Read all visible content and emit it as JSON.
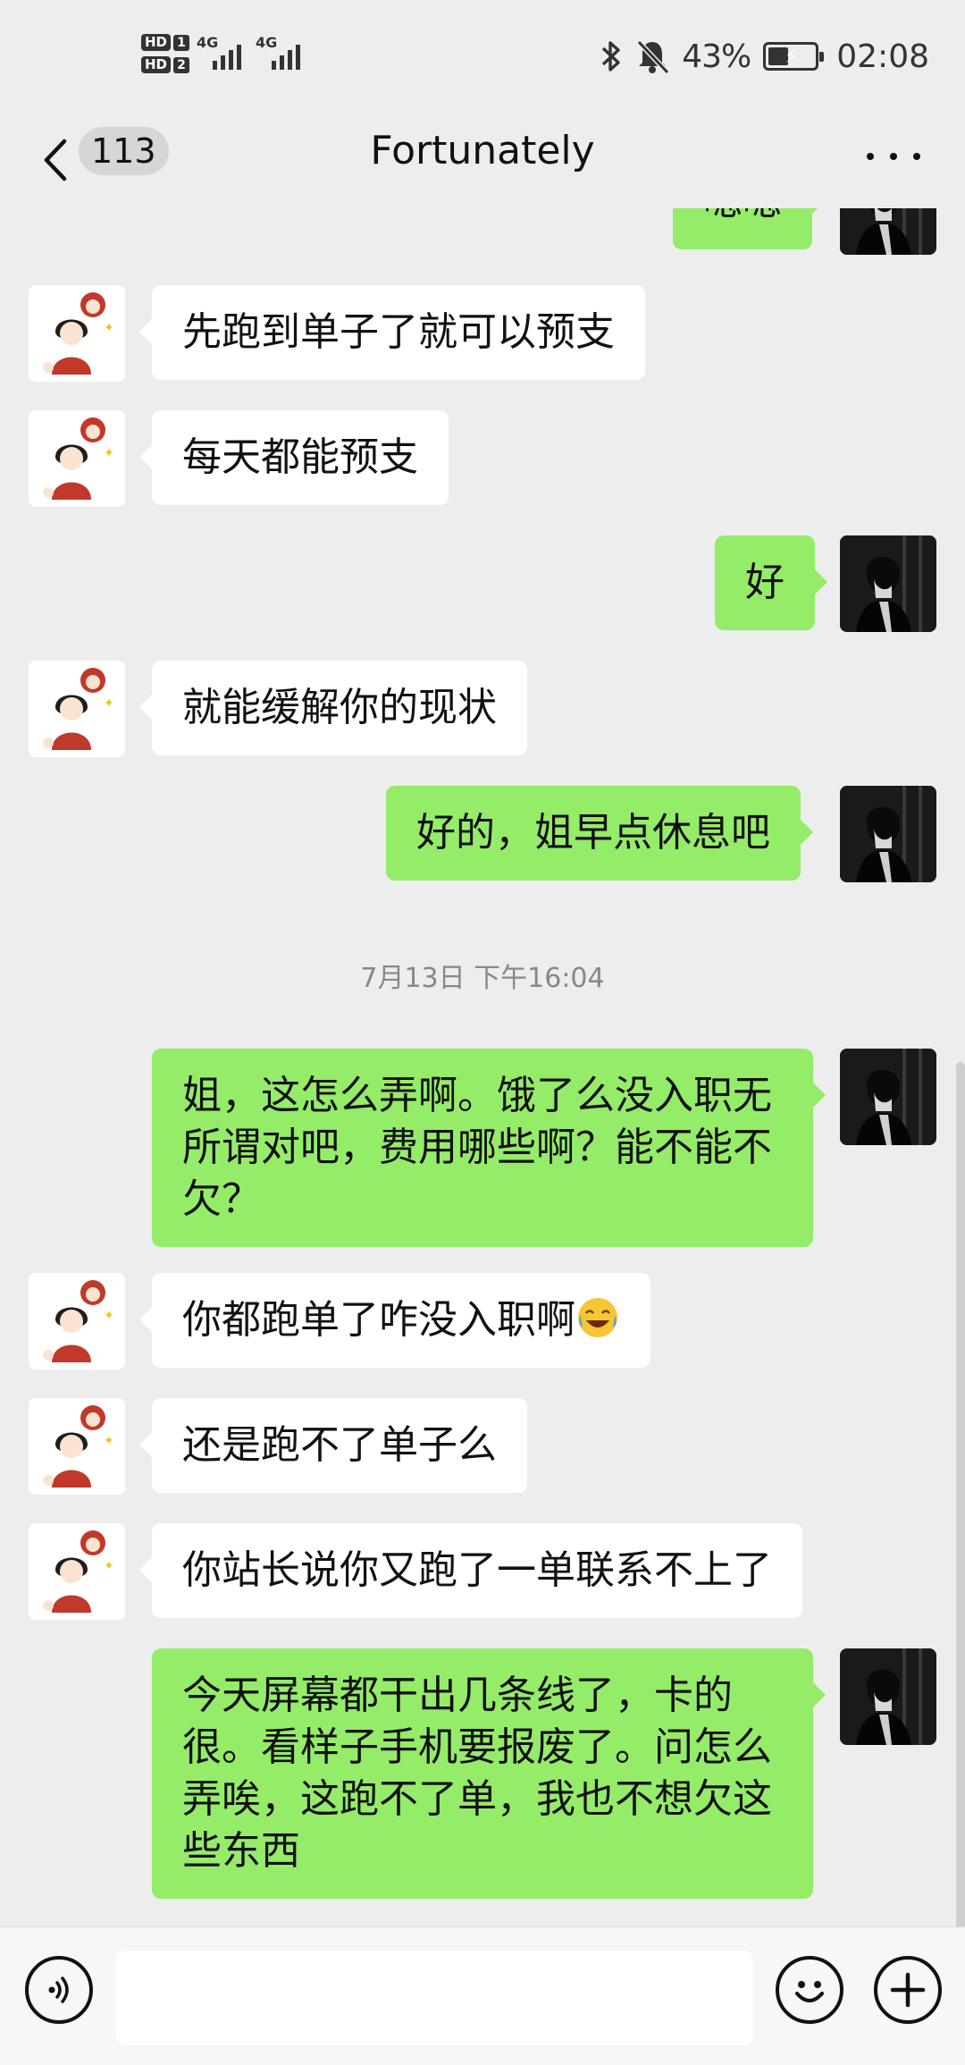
{
  "status_bar": {
    "hd1": "HD",
    "hd1_num": "1",
    "hd2": "HD",
    "hd2_num": "2",
    "net1": "4G",
    "net2": "4G",
    "battery_percent": "43%",
    "battery_level": 0.43,
    "time": "02:08",
    "icons": [
      "bluetooth-icon",
      "mute-bell-icon",
      "battery-charging-icon"
    ]
  },
  "nav": {
    "unread_count": "113",
    "title": "Fortunately",
    "back_icon": "chevron-left-icon",
    "more_icon": "more-dots-icon"
  },
  "messages": [
    {
      "side": "right",
      "text": "嗯嗯",
      "partial": true
    },
    {
      "side": "left",
      "text": "先跑到单子了就可以预支"
    },
    {
      "side": "left",
      "text": "每天都能预支"
    },
    {
      "side": "right",
      "text": "好"
    },
    {
      "side": "left",
      "text": "就能缓解你的现状"
    },
    {
      "side": "right",
      "text": "好的，姐早点休息吧"
    },
    {
      "type": "timestamp",
      "text": "7月13日 下午16:04"
    },
    {
      "side": "right",
      "text": "姐，这怎么弄啊。饿了么没入职无所谓对吧，费用哪些啊？能不能不欠？"
    },
    {
      "side": "left",
      "text": "你都跑单了咋没入职啊",
      "emoji": "laughing-crying-emoji"
    },
    {
      "side": "left",
      "text": "还是跑不了单子么"
    },
    {
      "side": "left",
      "text": "你站长说你又跑了一单联系不上了"
    },
    {
      "side": "right",
      "text": "今天屏幕都干出几条线了，卡的很。看样子手机要报废了。问怎么弄唉，这跑不了单，我也不想欠这些东西"
    }
  ],
  "input_bar": {
    "voice_icon": "voice-icon",
    "emoji_icon": "emoji-icon",
    "plus_icon": "plus-icon",
    "input_value": ""
  },
  "colors": {
    "background": "#ededed",
    "bubble_mine": "#95ec69",
    "bubble_theirs": "#ffffff"
  }
}
